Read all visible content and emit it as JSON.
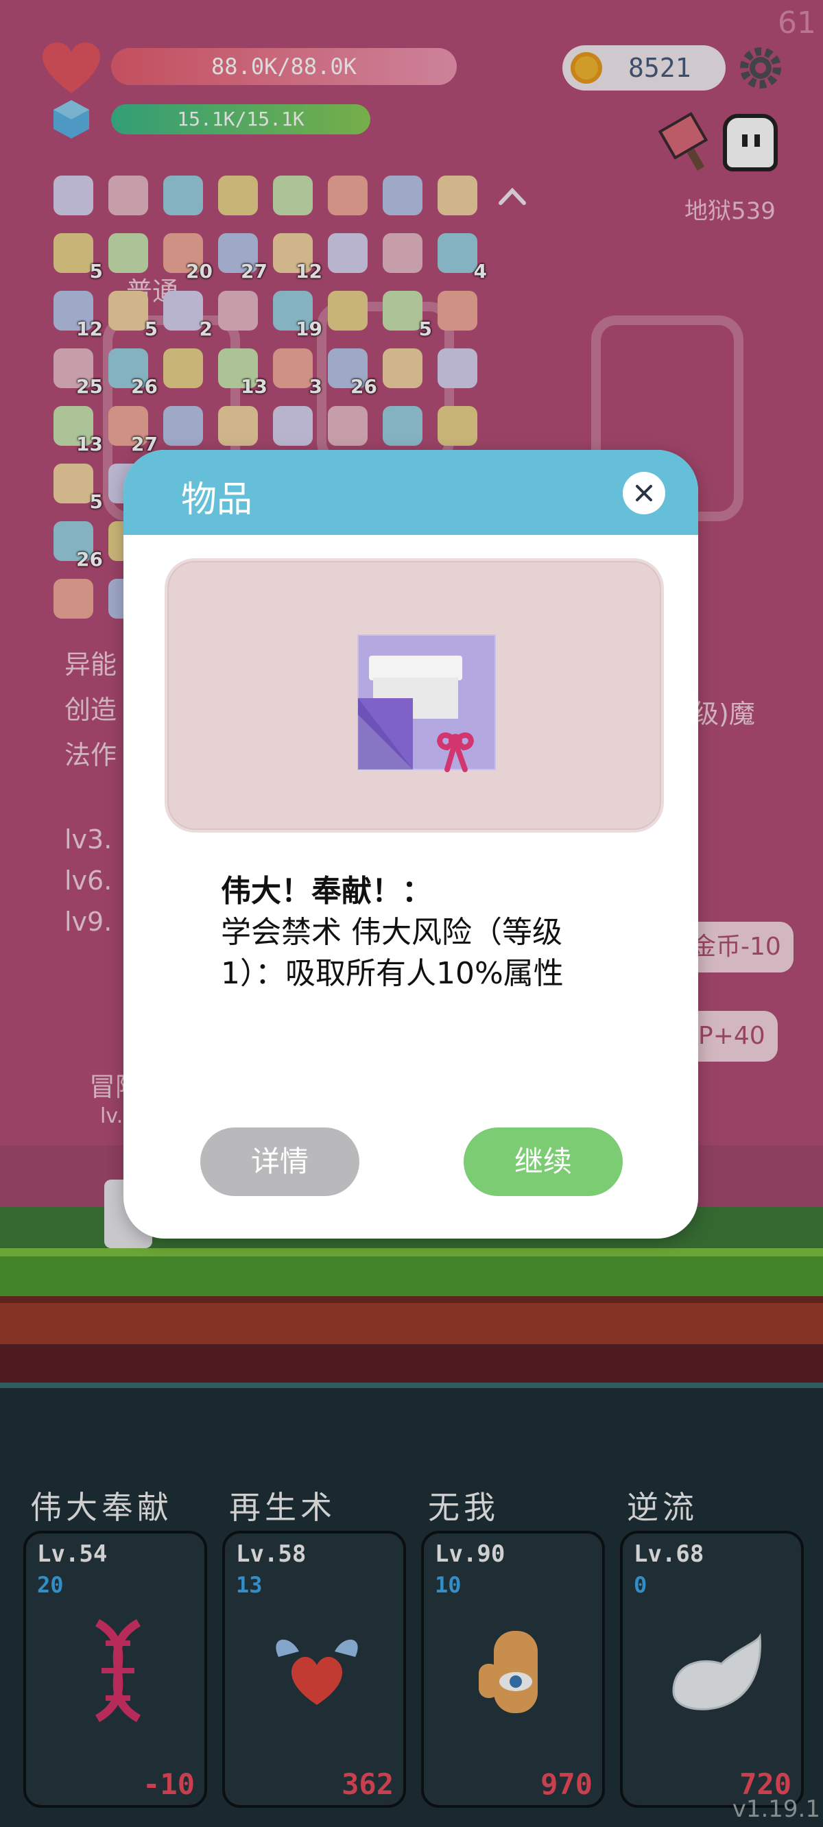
{
  "status": {
    "fps": "61",
    "hp": "88.0K/88.0K",
    "mp": "15.1K/15.1K",
    "gold": "8521",
    "hell_level": "地狱539"
  },
  "inventory": {
    "rows": [
      [
        {
          "icon": "gift-scroll-icon",
          "count": ""
        },
        {
          "icon": "gift-scroll-icon",
          "count": ""
        },
        {
          "icon": "gift-scroll-icon",
          "count": ""
        },
        {
          "icon": "spiral-icon",
          "count": ""
        },
        {
          "icon": "safety-pin-icon",
          "count": ""
        },
        {
          "icon": "egg-icon",
          "count": ""
        },
        {
          "icon": "mushroom-icon",
          "count": ""
        },
        {
          "icon": "sword-icon",
          "count": ""
        },
        {
          "icon": "collapse-up-icon",
          "count": ""
        }
      ],
      [
        {
          "icon": "strawberry-icon",
          "count": "5"
        },
        {
          "icon": "map-icon",
          "count": ""
        },
        {
          "icon": "map-icon",
          "count": "20"
        },
        {
          "icon": "flag-pot-icon",
          "count": "27"
        },
        {
          "icon": "watermelon-icon",
          "count": "12"
        },
        {
          "icon": "sun-icon",
          "count": ""
        },
        {
          "icon": "viking-helmet-icon",
          "count": ""
        },
        {
          "icon": "knife-icon",
          "count": "4"
        }
      ],
      [
        {
          "icon": "sparkle-icon",
          "count": "12"
        },
        {
          "icon": "axe-icon",
          "count": "5"
        },
        {
          "icon": "ring-icon",
          "count": "2"
        },
        {
          "icon": "molecule-icon",
          "count": ""
        },
        {
          "icon": "flower-icon",
          "count": "19"
        },
        {
          "icon": "meat-icon",
          "count": ""
        },
        {
          "icon": "envelope-icon",
          "count": "5"
        },
        {
          "icon": "pineapple-icon",
          "count": ""
        }
      ],
      [
        {
          "icon": "pirate-ship-icon",
          "count": "25"
        },
        {
          "icon": "ghost-icon",
          "count": "26"
        },
        {
          "icon": "beer-icon",
          "count": ""
        },
        {
          "icon": "apple-icon",
          "count": "13"
        },
        {
          "icon": "scroll-icon",
          "count": "3"
        },
        {
          "icon": "donut-icon",
          "count": "26"
        },
        {
          "icon": "bulb-icon",
          "count": ""
        },
        {
          "icon": "id-card-icon",
          "count": ""
        }
      ],
      [
        {
          "icon": "sword-icon",
          "count": "13"
        },
        {
          "icon": "heart-icon",
          "count": "27"
        },
        {
          "icon": "robe-icon",
          "count": ""
        },
        {
          "icon": "bag-icon",
          "count": ""
        },
        {
          "icon": "potion-icon",
          "count": ""
        },
        {
          "icon": "coins-icon",
          "count": ""
        },
        {
          "icon": "boot-icon",
          "count": ""
        },
        {
          "icon": "spike-ball-icon",
          "count": ""
        }
      ],
      [
        {
          "icon": "coconut-icon",
          "count": "5"
        },
        {
          "icon": "book-icon",
          "count": ""
        }
      ],
      [
        {
          "icon": "bomb-icon",
          "count": "26"
        },
        {
          "icon": "tomb-icon",
          "count": ""
        }
      ],
      [
        {
          "icon": "tea-icon",
          "count": ""
        },
        {
          "icon": "card-icon",
          "count": ""
        }
      ]
    ]
  },
  "background_labels": {
    "normal": "普通",
    "ability": "异能",
    "create": "创造",
    "technique": "法作",
    "lv3": "lv3.",
    "lv6": "lv6.",
    "lv9": "lv9.",
    "magic": "级)魔",
    "coin_cost": "金币-10",
    "p_bonus": "P+40",
    "adventure": "冒险",
    "lv_small": "lv."
  },
  "modal": {
    "title": "物品",
    "item_icon": "gift-scroll-icon",
    "item_name": "伟大！奉献！：",
    "item_desc": "学会禁术 伟大风险（等级1）：吸取所有人10%属性",
    "detail_label": "详情",
    "continue_label": "继续"
  },
  "skills": [
    {
      "title": "伟大奉献",
      "level": "Lv.54",
      "points": "20",
      "value": "-10",
      "icon": "dna-icon"
    },
    {
      "title": "再生术",
      "level": "Lv.58",
      "points": "13",
      "value": "362",
      "icon": "winged-heart-icon"
    },
    {
      "title": "无我",
      "level": "Lv.90",
      "points": "10",
      "value": "970",
      "icon": "eye-hand-icon"
    },
    {
      "title": "逆流",
      "level": "Lv.68",
      "points": "0",
      "value": "720",
      "icon": "wing-icon"
    }
  ],
  "version": "v1.19.1",
  "colors": {
    "bg": "#b34d76",
    "modal_header": "#66bfd8",
    "continue": "#7ccc73",
    "detail": "#b9b9bb",
    "skill_points": "#3aa6e8",
    "skill_value": "#ea4a5a"
  }
}
